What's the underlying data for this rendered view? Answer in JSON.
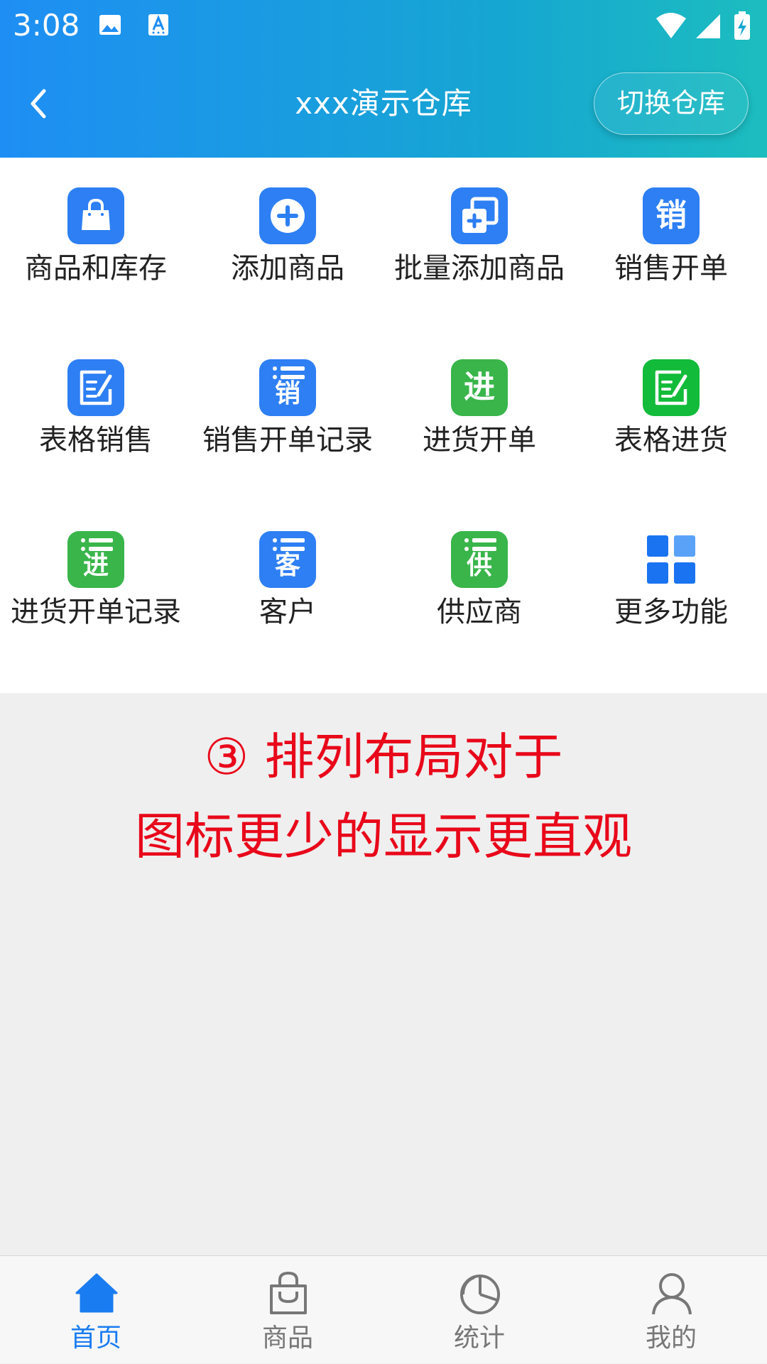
{
  "status_bar": {
    "time": "3:08"
  },
  "header": {
    "title": "xxx演示仓库",
    "switch_label": "切换仓库"
  },
  "grid": {
    "items": [
      {
        "label": "商品和库存",
        "icon": "shopping-bag-icon",
        "color": "#2d7ff3"
      },
      {
        "label": "添加商品",
        "icon": "plus-circle-icon",
        "color": "#2d7ff3"
      },
      {
        "label": "批量添加商品",
        "icon": "batch-add-icon",
        "color": "#2d7ff3"
      },
      {
        "label": "销售开单",
        "icon": "sales-icon",
        "glyph": "销",
        "color": "#2d7ff3"
      },
      {
        "label": "表格销售",
        "icon": "table-edit-icon",
        "color": "#2d7ff3"
      },
      {
        "label": "销售开单记录",
        "icon": "sales-record-icon",
        "glyph": "销",
        "color": "#2d7ff3"
      },
      {
        "label": "进货开单",
        "icon": "purchase-icon",
        "glyph": "进",
        "color": "#39b54a"
      },
      {
        "label": "表格进货",
        "icon": "table-edit-icon",
        "color": "#12bb39"
      },
      {
        "label": "进货开单记录",
        "icon": "purchase-record-icon",
        "glyph": "进",
        "color": "#39b54a"
      },
      {
        "label": "客户",
        "icon": "customer-icon",
        "glyph": "客",
        "color": "#2d7ff3"
      },
      {
        "label": "供应商",
        "icon": "supplier-icon",
        "glyph": "供",
        "color": "#39b54a"
      },
      {
        "label": "更多功能",
        "icon": "grid-more-icon",
        "color": "#1a73f0"
      }
    ]
  },
  "caption": {
    "line1": "③ 排列布局对于",
    "line2": "图标更少的显示更直观",
    "color": "#e8081a"
  },
  "tabbar": {
    "tabs": [
      {
        "label": "首页",
        "icon": "home-icon",
        "active": true
      },
      {
        "label": "商品",
        "icon": "bag-icon",
        "active": false
      },
      {
        "label": "统计",
        "icon": "pie-chart-icon",
        "active": false
      },
      {
        "label": "我的",
        "icon": "user-icon",
        "active": false
      }
    ]
  }
}
